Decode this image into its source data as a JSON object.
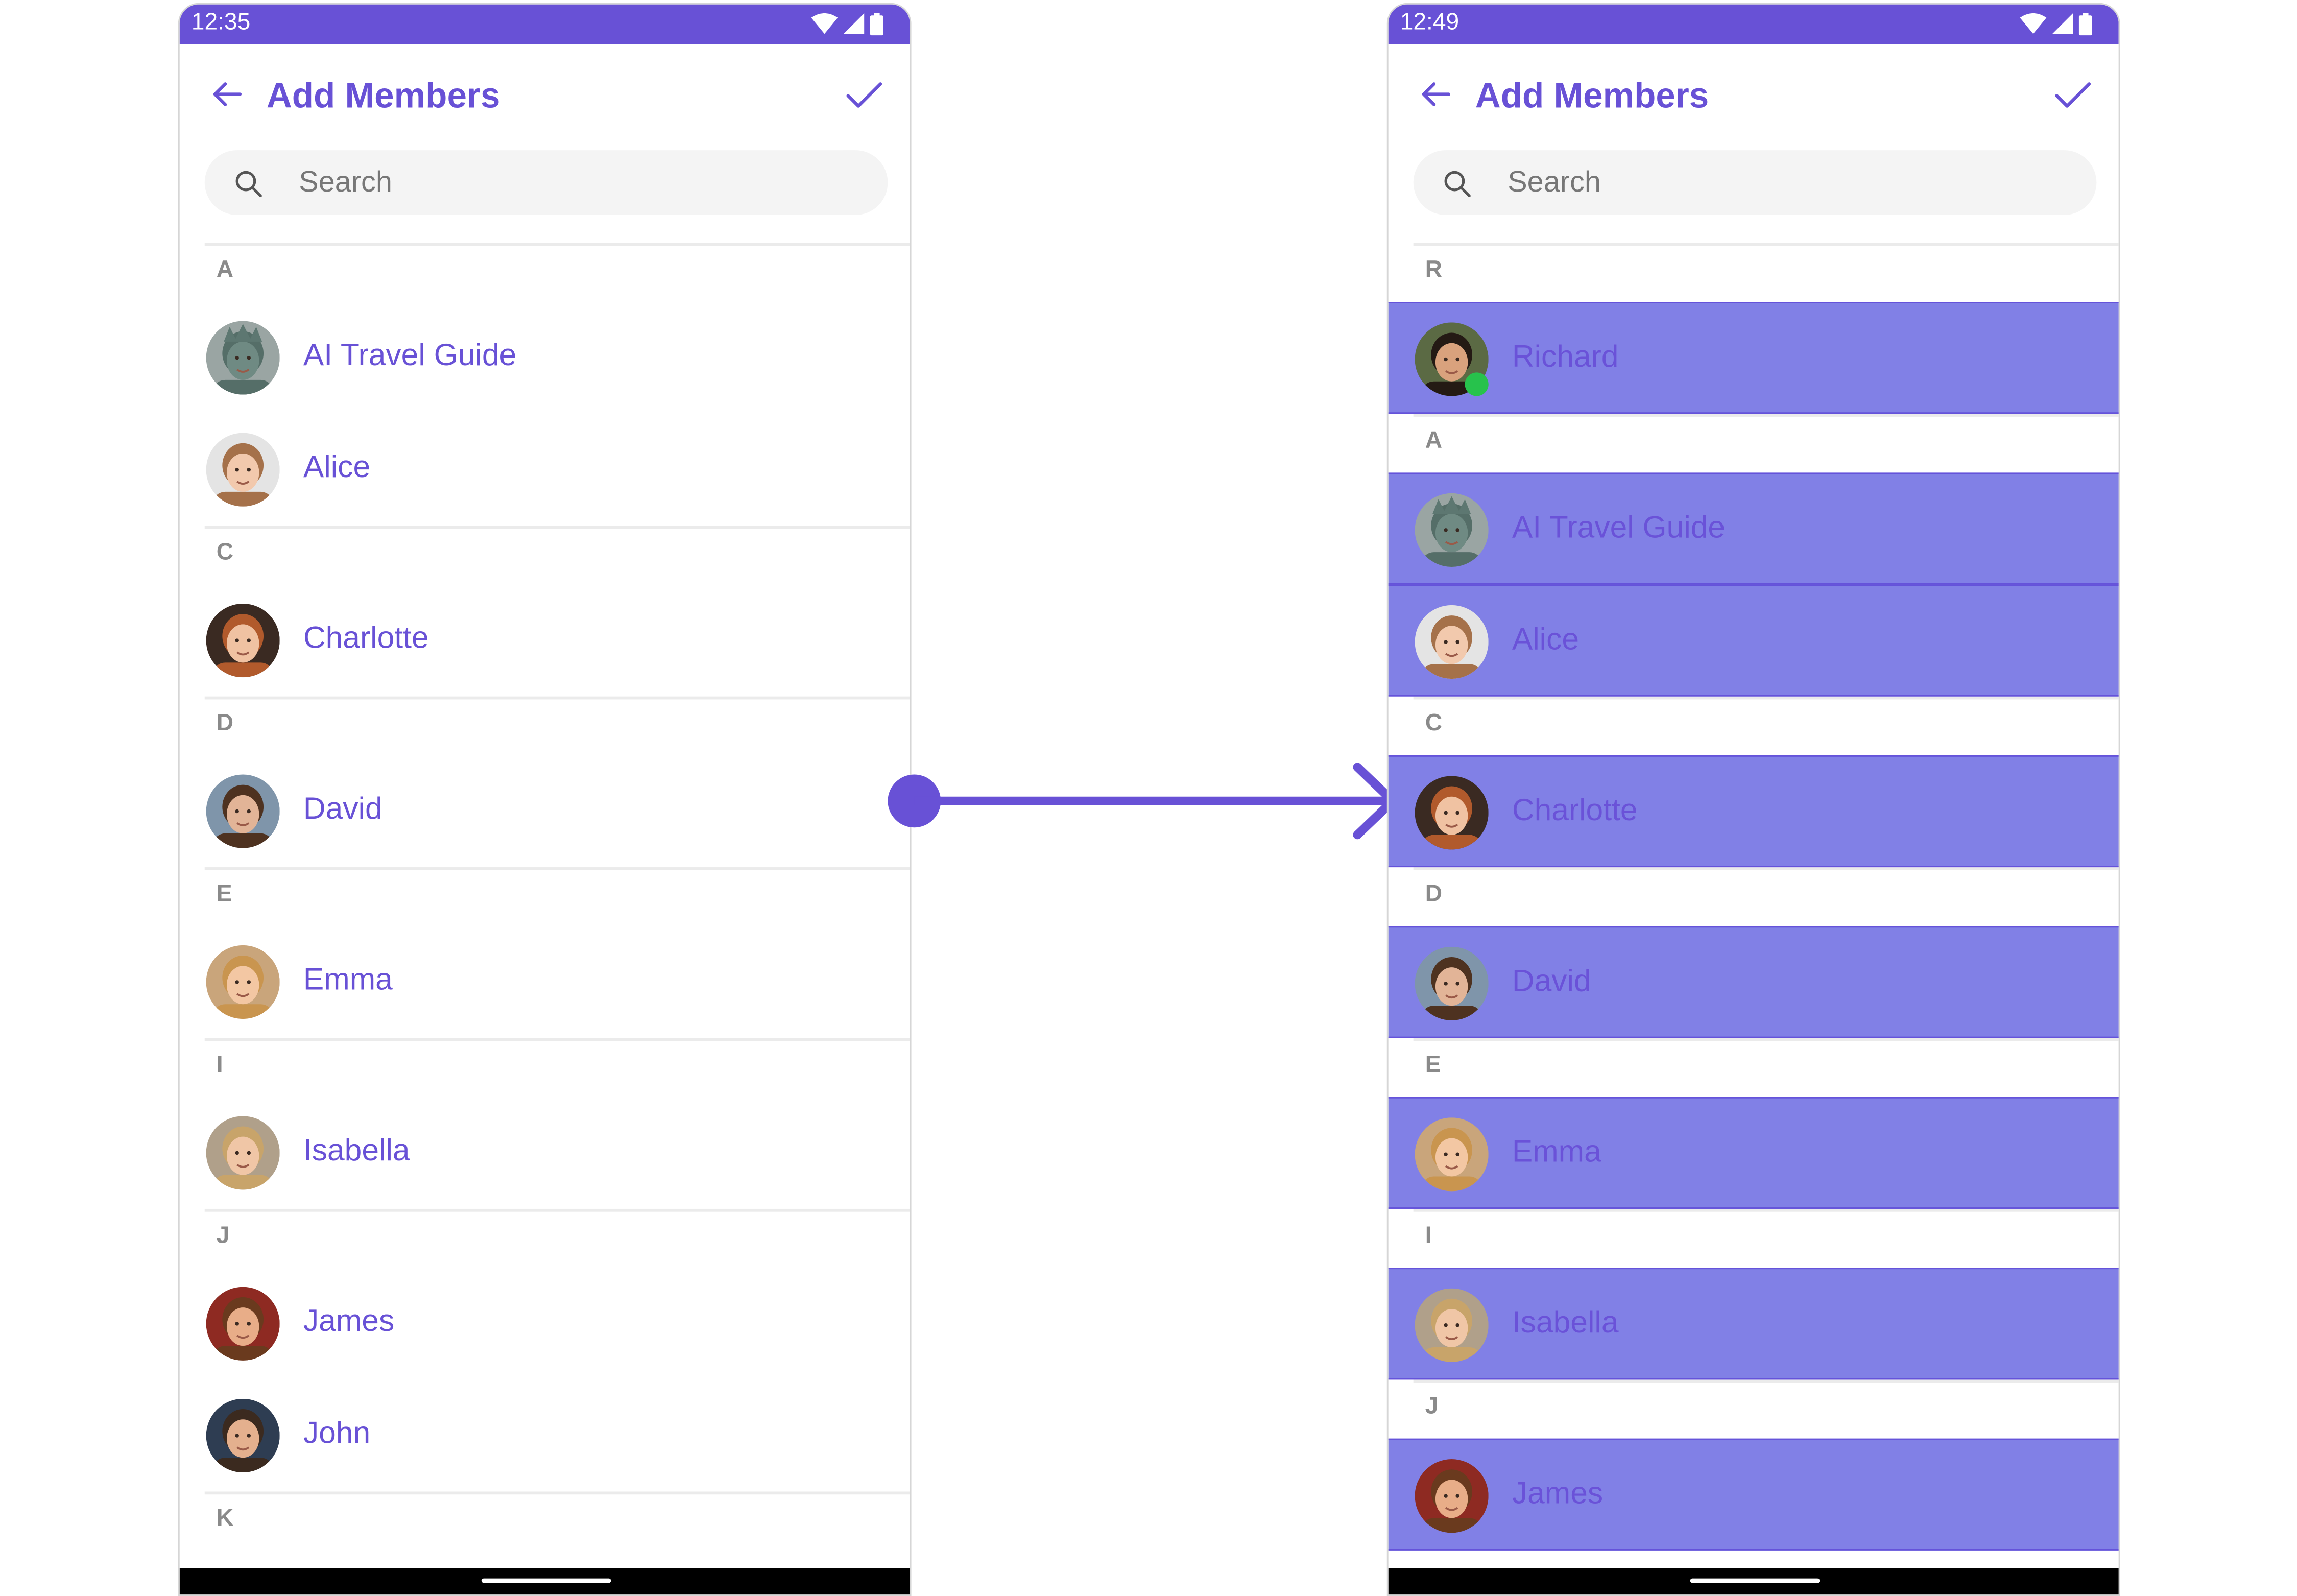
{
  "colors": {
    "accent": "#6851d6",
    "selected_row": "#8180e6",
    "online": "#27c24c"
  },
  "left": {
    "time": "12:35",
    "title": "Add Members",
    "search_placeholder": "Search",
    "sections": [
      {
        "letter": "A",
        "items": [
          {
            "name": "AI Travel Guide",
            "avatar": "statue"
          },
          {
            "name": "Alice",
            "avatar": "woman-light"
          }
        ]
      },
      {
        "letter": "C",
        "items": [
          {
            "name": "Charlotte",
            "avatar": "woman-red"
          }
        ]
      },
      {
        "letter": "D",
        "items": [
          {
            "name": "David",
            "avatar": "man-brown"
          }
        ]
      },
      {
        "letter": "E",
        "items": [
          {
            "name": "Emma",
            "avatar": "woman-blonde"
          }
        ]
      },
      {
        "letter": "I",
        "items": [
          {
            "name": "Isabella",
            "avatar": "woman-blonde2"
          }
        ]
      },
      {
        "letter": "J",
        "items": [
          {
            "name": "James",
            "avatar": "man-red"
          },
          {
            "name": "John",
            "avatar": "man-dark"
          }
        ]
      },
      {
        "letter": "K",
        "items": []
      }
    ]
  },
  "right": {
    "time": "12:49",
    "title": "Add Members",
    "search_placeholder": "Search",
    "sections": [
      {
        "letter": "R",
        "items": [
          {
            "name": "Richard",
            "avatar": "man-dark2",
            "online": true,
            "selected": true
          }
        ]
      },
      {
        "letter": "A",
        "items": [
          {
            "name": "AI Travel Guide",
            "avatar": "statue",
            "selected": true
          },
          {
            "name": "Alice",
            "avatar": "woman-light",
            "selected": true
          }
        ]
      },
      {
        "letter": "C",
        "items": [
          {
            "name": "Charlotte",
            "avatar": "woman-red",
            "selected": true
          }
        ]
      },
      {
        "letter": "D",
        "items": [
          {
            "name": "David",
            "avatar": "man-brown",
            "selected": true
          }
        ]
      },
      {
        "letter": "E",
        "items": [
          {
            "name": "Emma",
            "avatar": "woman-blonde",
            "selected": true
          }
        ]
      },
      {
        "letter": "I",
        "items": [
          {
            "name": "Isabella",
            "avatar": "woman-blonde2",
            "selected": true
          }
        ]
      },
      {
        "letter": "J",
        "items": [
          {
            "name": "James",
            "avatar": "man-red",
            "selected": true
          }
        ]
      }
    ]
  }
}
